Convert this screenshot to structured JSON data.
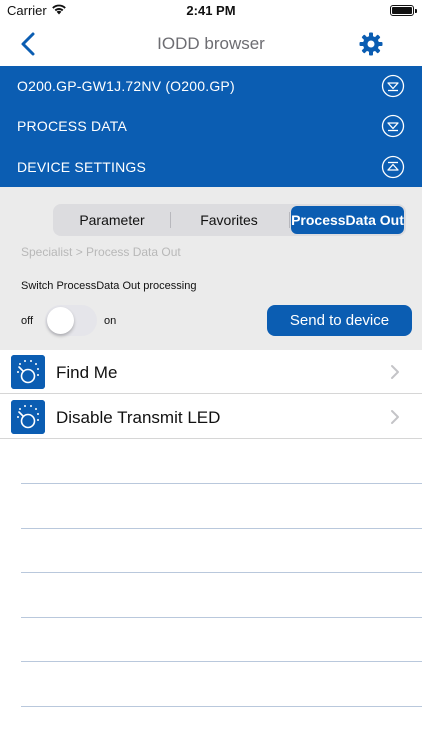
{
  "status_bar": {
    "carrier": "Carrier",
    "time": "2:41 PM"
  },
  "nav": {
    "title": "IODD browser",
    "back_icon": "chevron-left-icon",
    "settings_icon": "gear-icon"
  },
  "sections": [
    {
      "label": "O200.GP-GW1J.72NV (O200.GP)",
      "icon": "collapse-circle-icon"
    },
    {
      "label": "PROCESS DATA",
      "icon": "collapse-circle-icon"
    },
    {
      "label": "DEVICE SETTINGS",
      "icon": "expand-circle-icon"
    }
  ],
  "tabs": [
    {
      "label": "Parameter",
      "selected": false
    },
    {
      "label": "Favorites",
      "selected": false
    },
    {
      "label": "ProcessData Out",
      "selected": true
    }
  ],
  "breadcrumb": "Specialist > Process Data Out",
  "switch": {
    "caption": "Switch ProcessData Out processing",
    "off_label": "off",
    "on_label": "on",
    "state": false
  },
  "send_button": "Send to device",
  "list": [
    {
      "label": "Find Me",
      "icon": "dial-icon"
    },
    {
      "label": "Disable Transmit LED",
      "icon": "dial-icon"
    }
  ],
  "colors": {
    "accent": "#0b5db2",
    "panel_bg": "#ebebeb"
  }
}
